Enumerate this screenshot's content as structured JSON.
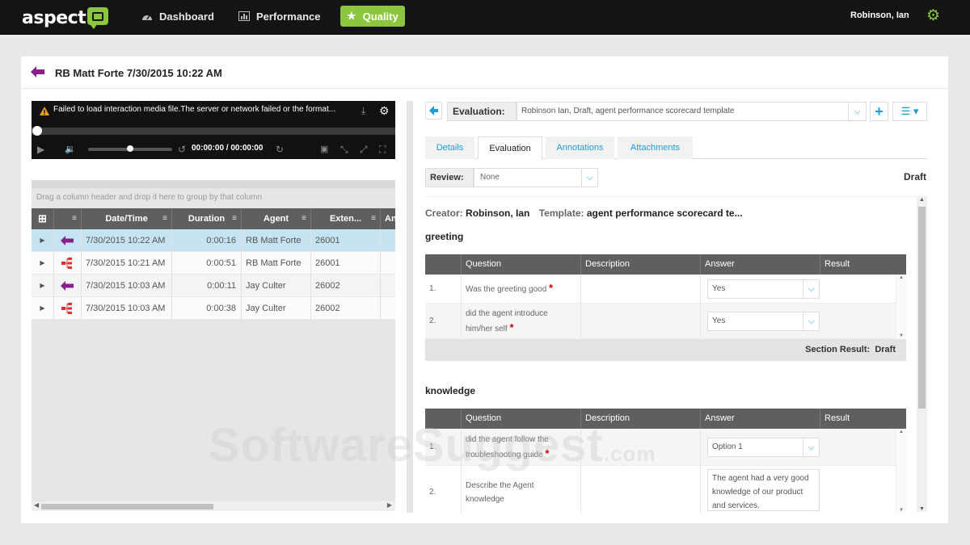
{
  "brand": {
    "logo": "aspect",
    "accent": "#8cc63f",
    "link": "#1e9bd7"
  },
  "nav": {
    "dashboard": "Dashboard",
    "performance": "Performance",
    "quality": "Quality",
    "user": "Robinson, Ian"
  },
  "page": {
    "title": "RB Matt Forte 7/30/2015 10:22 AM"
  },
  "player": {
    "error": "Failed to load interaction media file.The server or network failed or the format...",
    "time": "00:00:00  /  00:00:00"
  },
  "grid": {
    "group_hint": "Drag a column header and drop it here to group by that column",
    "columns": [
      "Date/Time",
      "Duration",
      "Agent",
      "Exten...",
      "An"
    ],
    "rows": [
      {
        "icon": "inbound-arrow-icon",
        "datetime": "7/30/2015 10:22 AM",
        "duration": "0:00:16",
        "agent": "RB Matt Forte",
        "ext": "26001",
        "selected": true
      },
      {
        "icon": "org-chart-icon",
        "datetime": "7/30/2015 10:21 AM",
        "duration": "0:00:51",
        "agent": "RB Matt Forte",
        "ext": "26001",
        "selected": false
      },
      {
        "icon": "inbound-arrow-icon",
        "datetime": "7/30/2015 10:03 AM",
        "duration": "0:00:11",
        "agent": "Jay Culter",
        "ext": "26002",
        "selected": false
      },
      {
        "icon": "org-chart-icon",
        "datetime": "7/30/2015 10:03 AM",
        "duration": "0:00:38",
        "agent": "Jay Culter",
        "ext": "26002",
        "selected": false
      }
    ]
  },
  "evaluation": {
    "label": "Evaluation:",
    "value": "Robinson Ian, Draft, agent performance scorecard template",
    "tabs": [
      "Details",
      "Evaluation",
      "Annotations",
      "Attachments"
    ],
    "active_tab": "Evaluation",
    "review_label": "Review:",
    "review_value": "None",
    "status": "Draft",
    "creator_key": "Creator:",
    "creator_value": "Robinson, Ian",
    "template_key": "Template:",
    "template_value": "agent performance scorecard te..."
  },
  "table_headers": [
    "Question",
    "Description",
    "Answer",
    "Result"
  ],
  "sections": {
    "greeting": {
      "title": "greeting",
      "questions": [
        {
          "num": "1.",
          "text": "Was the greeting good",
          "answer": "Yes"
        },
        {
          "num": "2.",
          "text_line1": "did the agent introduce",
          "text_line2": "him/her self",
          "answer": "Yes"
        }
      ],
      "result_label": "Section Result:",
      "result_value": "Draft"
    },
    "knowledge": {
      "title": "knowledge",
      "questions": [
        {
          "num": "1.",
          "text_line1": "did the agent follow the",
          "text_line2": "troubleshooting guide",
          "answer": "Option 1"
        },
        {
          "num": "2.",
          "text_line1": "Describe the Agent",
          "text_line2": "knowledge",
          "answer": "The agent had a very good knowledge of our product and services."
        }
      ]
    }
  },
  "watermark": {
    "main": "SoftwareSuggest",
    "suffix": ".com"
  }
}
